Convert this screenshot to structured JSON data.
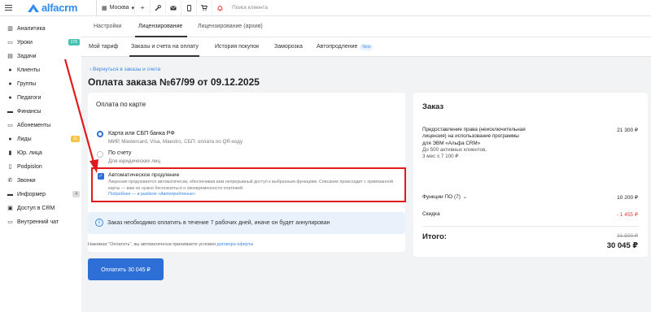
{
  "topbar": {
    "logo_text": "alfacrm",
    "city": "Москва",
    "search_placeholder": "Поиск клиента"
  },
  "sidebar": {
    "items": [
      {
        "label": "Аналитика",
        "icon": "analytics-icon"
      },
      {
        "label": "Уроки",
        "icon": "lessons-icon",
        "badge": "176"
      },
      {
        "label": "Задачи",
        "icon": "tasks-icon"
      },
      {
        "label": "Клиенты",
        "icon": "clients-icon"
      },
      {
        "label": "Группы",
        "icon": "groups-icon"
      },
      {
        "label": "Педагоги",
        "icon": "teachers-icon"
      },
      {
        "label": "Финансы",
        "icon": "finance-icon"
      },
      {
        "label": "Абонементы",
        "icon": "subscriptions-icon"
      },
      {
        "label": "Лиды",
        "icon": "leads-icon",
        "badge": "11"
      },
      {
        "label": "Юр. лица",
        "icon": "legal-entities-icon"
      },
      {
        "label": "Podpislon",
        "icon": "podpislon-icon"
      },
      {
        "label": "Звонки",
        "icon": "calls-icon"
      },
      {
        "label": "Информер",
        "icon": "informer-icon",
        "badge": "4"
      },
      {
        "label": "Доступ в CRM",
        "icon": "lock-icon"
      },
      {
        "label": "Внутренний чат",
        "icon": "chat-icon"
      }
    ]
  },
  "tabs_primary": [
    {
      "label": "Настройки"
    },
    {
      "label": "Лицензирование",
      "active": true
    },
    {
      "label": "Лицензирование (архив)"
    }
  ],
  "tabs_secondary": [
    {
      "label": "Мой тариф"
    },
    {
      "label": "Заказы и счета на оплату",
      "active": true
    },
    {
      "label": "История покупок"
    },
    {
      "label": "Заморозка"
    },
    {
      "label": "Автопродление",
      "badge": "New"
    }
  ],
  "back_link": "Вернуться в заказы и счета",
  "page_title": "Оплата заказа №67/99 от 09.12.2025",
  "payment": {
    "header": "Оплата по карте",
    "options": [
      {
        "title": "Карта или СБП банка РФ",
        "subtitle": "МИР, Mastercard, Visa, Maestro, СБП: оплата по QR-коду",
        "selected": true
      },
      {
        "title": "По счету",
        "subtitle": "Для юридических лиц",
        "selected": false
      }
    ],
    "auto_renew": {
      "checked": true,
      "title": "Автоматическое продление",
      "description": "Лицензия продлевается автоматически, обеспечивая вам непрерывный доступ к выбранным функциям. Списание происходит с привязанной карты — вам не нужно беспокоиться о своевременности платежей.",
      "link": "Подробнее — в разделе «Автопродление»"
    }
  },
  "info_notice": "Заказ необходимо оплатить в течение 7 рабочих дней, иначе он будет аннулирован",
  "oferta": {
    "text": "Нажимая \"Оплатить\", вы автоматически принимаете условия",
    "link": "договора оферты"
  },
  "pay_button": "Оплатить 30 045 ₽",
  "order": {
    "title": "Заказ",
    "main_item": {
      "title": "Предоставление права (неисключительная лицензия) на использование программы для ЭВМ «Альфа CRM»",
      "detail1": "До 500 активных клиентов,",
      "detail2": "3 мес х 7 100 ₽",
      "amount": "21 300 ₽"
    },
    "functions": {
      "label": "Функции ПО (7)",
      "amount": "10 200 ₽"
    },
    "discount": {
      "label": "Скидка",
      "amount": "- 1 455 ₽"
    },
    "total_label": "Итого:",
    "old_total": "31 500 ₽",
    "total": "30 045 ₽"
  },
  "colors": {
    "accent": "#2d6fd6",
    "highlight_box": "#e11b1b",
    "discount": "#e53935"
  }
}
